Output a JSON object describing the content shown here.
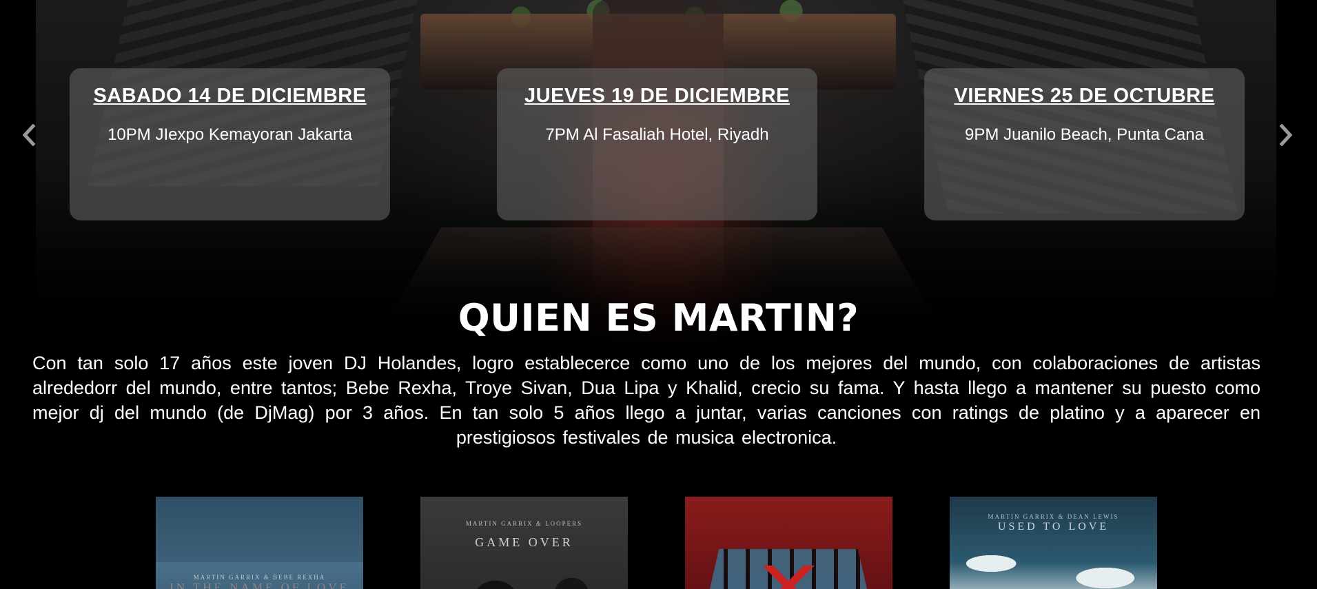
{
  "carousel": {
    "prev_icon": "chevron-left-icon",
    "next_icon": "chevron-right-icon",
    "events": [
      {
        "date": "SABADO 14 DE DICIEMBRE",
        "info": "10PM JIexpo Kemayoran Jakarta"
      },
      {
        "date": "JUEVES 19 DE DICIEMBRE",
        "info": "7PM Al Fasaliah Hotel, Riyadh"
      },
      {
        "date": "VIERNES 25 DE OCTUBRE",
        "info": "9PM Juanilo Beach, Punta Cana"
      }
    ]
  },
  "about": {
    "title": "QUIEN ES MARTIN?",
    "text": "Con tan solo 17 años este joven DJ Holandes, logro establecerce como uno de los mejores del mundo, con colaboraciones de artistas alrededorr del mundo, entre tantos; Bebe Rexha, Troye Sivan, Dua Lipa y Khalid, crecio su fama. Y hasta llego a mantener su puesto como mejor dj del mundo (de DjMag) por 3 años. En tan solo 5 años llego a juntar, varias canciones con ratings de platino y a aparecer en prestigiosos festivales de musica electronica."
  },
  "albums": [
    {
      "artist": "MARTIN GARRIX & BEBE REXHA",
      "name": "IN THE NAME OF LOVE"
    },
    {
      "artist": "MARTIN GARRIX & LOOPERS",
      "name": "GAME OVER"
    },
    {
      "artist": "",
      "name": ""
    },
    {
      "artist": "MARTIN GARRIX & DEAN LEWIS",
      "name": "USED TO LOVE"
    }
  ],
  "colors": {
    "background": "#000000",
    "card": "rgba(95,95,95,0.62)",
    "text": "#ffffff"
  }
}
